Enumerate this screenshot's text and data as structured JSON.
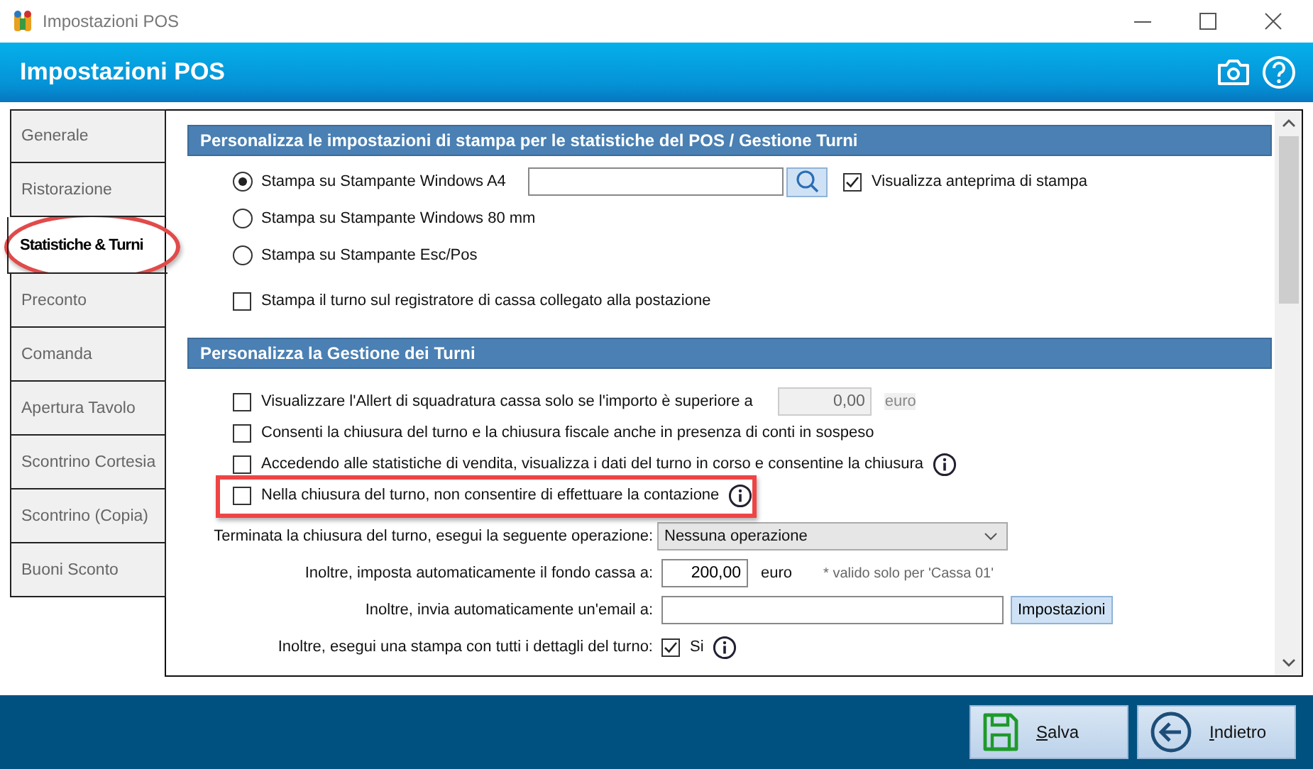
{
  "window": {
    "title": "Impostazioni POS"
  },
  "header": {
    "title": "Impostazioni POS"
  },
  "tabs": [
    {
      "label": "Generale",
      "selected": false
    },
    {
      "label": "Ristorazione",
      "selected": false
    },
    {
      "label": "Statistiche & Turni",
      "selected": true
    },
    {
      "label": "Preconto",
      "selected": false
    },
    {
      "label": "Comanda",
      "selected": false
    },
    {
      "label": "Apertura Tavolo",
      "selected": false
    },
    {
      "label": "Scontrino Cortesia",
      "selected": false
    },
    {
      "label": "Scontrino (Copia)",
      "selected": false
    },
    {
      "label": "Buoni Sconto",
      "selected": false
    }
  ],
  "print_section": {
    "title": "Personalizza le impostazioni di stampa per le statistiche del POS / Gestione Turni",
    "options": [
      {
        "label": "Stampa su Stampante Windows A4",
        "selected": true
      },
      {
        "label": "Stampa su Stampante Windows 80 mm",
        "selected": false
      },
      {
        "label": "Stampa su Stampante Esc/Pos",
        "selected": false
      }
    ],
    "preview": {
      "label": "Visualizza anteprima di stampa",
      "checked": true
    },
    "register": {
      "label": "Stampa il turno sul registratore di cassa collegato alla postazione",
      "checked": false
    }
  },
  "shift_section": {
    "title": "Personalizza la Gestione dei Turni",
    "checks": [
      {
        "label": "Visualizzare l'Allert di squadratura cassa solo se l'importo è superiore a",
        "checked": false,
        "amount": {
          "value": "0,00",
          "disabled": true
        },
        "unit": "euro",
        "info": false
      },
      {
        "label": "Consenti la chiusura del turno e la chiusura fiscale anche in presenza di conti in sospeso",
        "checked": false,
        "info": false
      },
      {
        "label": "Accedendo alle statistiche di vendita, visualizza i dati del turno in corso e consentine la chiusura",
        "checked": false,
        "info": true
      },
      {
        "label": "Nella chiusura del turno, non consentire di effettuare la contazione",
        "checked": false,
        "info": true
      }
    ],
    "after_close": {
      "label": "Terminata la chiusura del turno, esegui la seguente operazione:",
      "value": "Nessuna operazione"
    },
    "cash_fund": {
      "label": "Inoltre, imposta automaticamente il fondo cassa a:",
      "value": "200,00",
      "unit": "euro",
      "note": "* valido solo per 'Cassa 01'"
    },
    "email": {
      "label": "Inoltre, invia automaticamente un'email a:",
      "button": "Impostazioni"
    },
    "print_details": {
      "label": "Inoltre, esegui una stampa con tutti i dettagli del turno:",
      "option": "Si",
      "checked": true,
      "info": true
    }
  },
  "buttons": [
    {
      "label": "Salva",
      "kind": "save"
    },
    {
      "label": "Indietro",
      "kind": "back"
    }
  ]
}
